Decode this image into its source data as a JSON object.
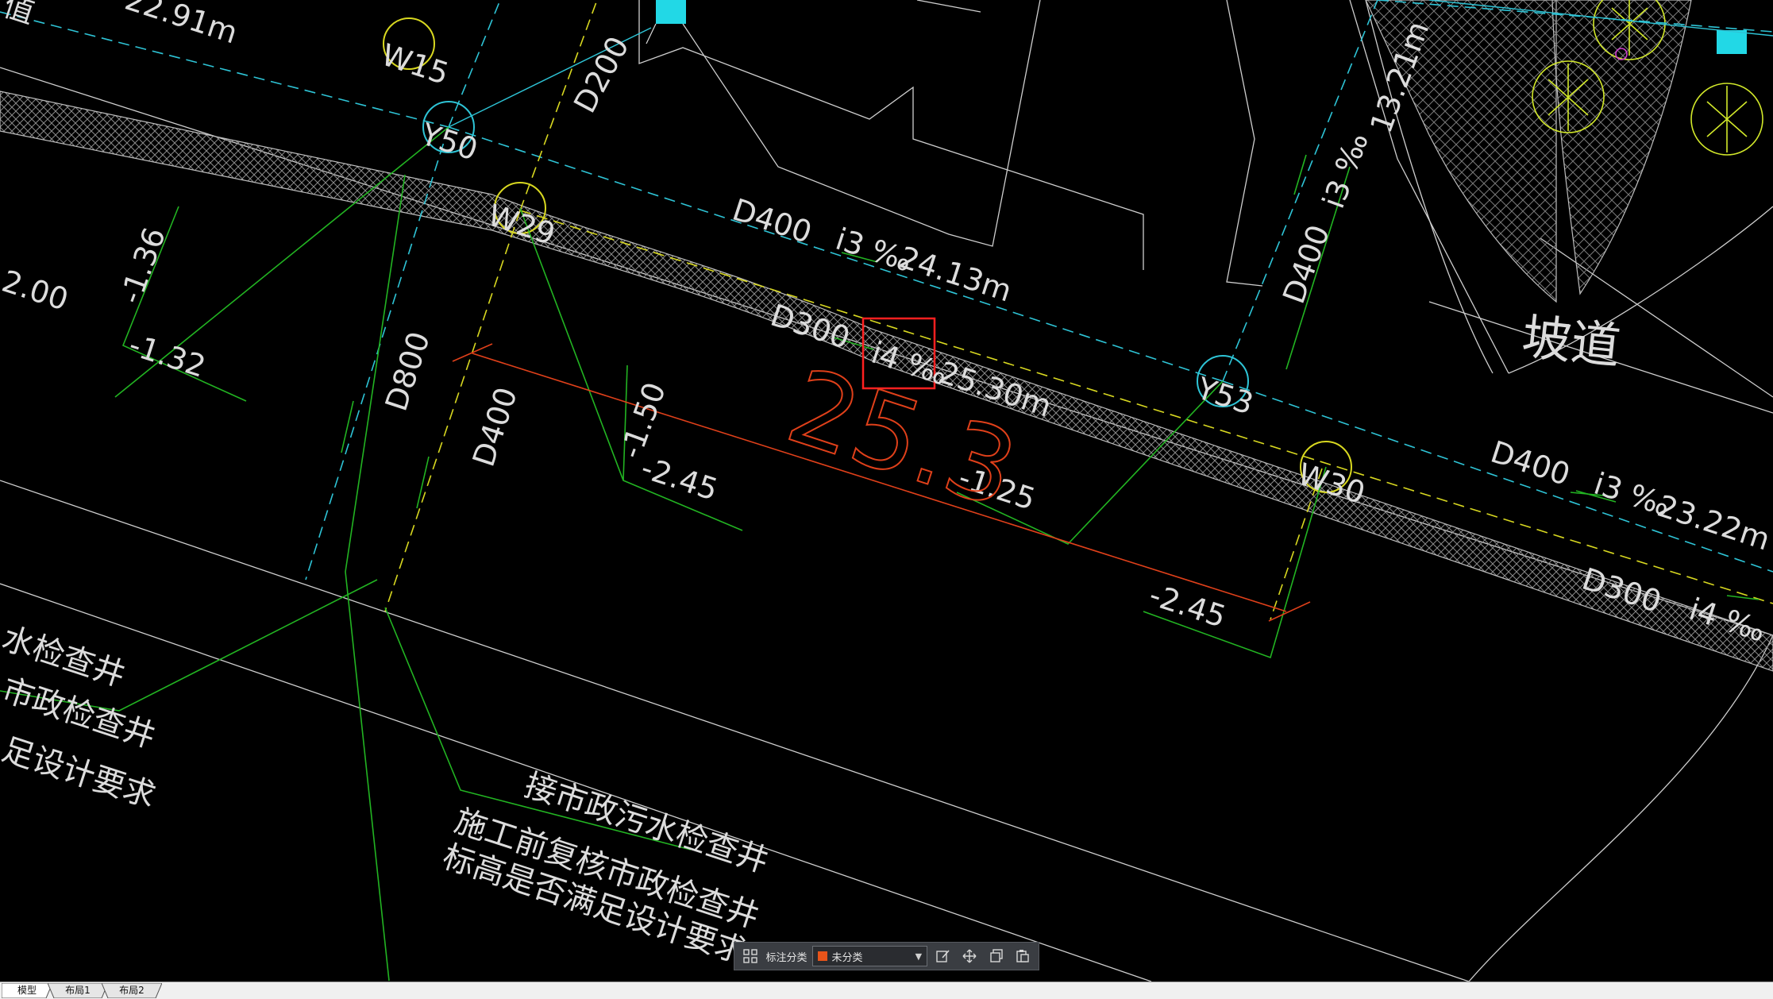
{
  "drawing": {
    "manholes": {
      "w15": "W15",
      "y50": "Y50",
      "w29": "W29",
      "y53": "Y53",
      "w30": "W30"
    },
    "pipes": {
      "d200": "D200",
      "d400_upper": "D400",
      "slope_upper": "i3 ‰",
      "length_upper": "24.13m",
      "d300_mid": "D300",
      "slope_mid": "i4 ‰",
      "length_mid": "25.30m",
      "d800": "D800",
      "d400_vertical": "D400",
      "d400_right_vertical": "D400",
      "slope_right_vertical": "i3 ‰",
      "length_right_vertical": "13.21m",
      "d400_right": "D400",
      "slope_right": "i3 ‰",
      "length_right": "23.22m",
      "d300_right": "D300",
      "slope_right_lower": "i4 ‰",
      "length_top_left": "22.91m"
    },
    "elevations": {
      "e1": "-1.36",
      "e2": "-1.32",
      "e3": "2.00",
      "e4": "-1.50",
      "e5": "-2.45",
      "e6": "-1.25",
      "e7": "-2.45"
    },
    "dimension_text": "25.3",
    "ramp_label": "坡道",
    "note_center": {
      "line1": "接市政污水检查井",
      "line2": "施工前复核市政检查井",
      "line3": "标高是否满足设计要求"
    },
    "note_left": {
      "line1": "水检查井",
      "line2": "市政检查井",
      "line3": "足设计要求"
    },
    "corner_text": "值"
  },
  "toolbar": {
    "label": "标注分类",
    "selected": "未分类",
    "swatch_color": "#e8541a",
    "icons": [
      "layout-grid-icon",
      "edit-icon",
      "move-icon",
      "copy-icon",
      "paste-icon"
    ]
  },
  "tabs": [
    "模型",
    "布局1",
    "布局2"
  ],
  "colors": {
    "cyan": "#2ec4d6",
    "yellow": "#d8d820",
    "green": "#22b422",
    "white": "#dcdcdc",
    "red": "#e0401a",
    "highlight": "#ff2020"
  }
}
